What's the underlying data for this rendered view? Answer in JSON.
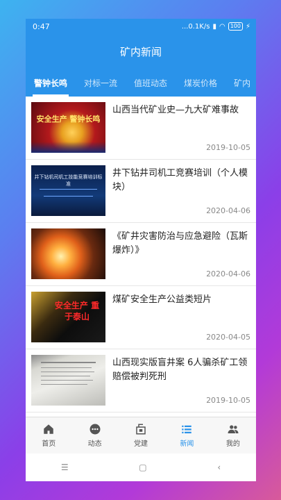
{
  "statusbar": {
    "time": "0:47",
    "speed": "...0.1K/s",
    "battery": "100"
  },
  "header": {
    "title": "矿内新闻"
  },
  "tabs": [
    {
      "label": "警钟长鸣"
    },
    {
      "label": "对标一流"
    },
    {
      "label": "值班动态"
    },
    {
      "label": "煤炭价格"
    },
    {
      "label": "矿内"
    }
  ],
  "news": [
    {
      "title": "山西当代矿业史—九大矿难事故",
      "date": "2019-10-05",
      "thumb_text": "安全生产 警钟长鸣"
    },
    {
      "title": "井下钻井司机工竞赛培训（个人模块）",
      "date": "2020-04-06",
      "thumb_text": "井下钻机司机工技能竞赛培训标准"
    },
    {
      "title": "《矿井灾害防治与应急避险（瓦斯爆炸）》",
      "date": "2020-04-06",
      "thumb_text": ""
    },
    {
      "title": "煤矿安全生产公益类短片",
      "date": "2020-04-05",
      "thumb_text": "安全生产 重于泰山"
    },
    {
      "title": "山西现实版盲井案 6人骗杀矿工领赔偿被判死刑",
      "date": "2019-10-05",
      "thumb_text": ""
    }
  ],
  "bottomnav": [
    {
      "label": "首页",
      "icon": "home-icon"
    },
    {
      "label": "动态",
      "icon": "chat-icon"
    },
    {
      "label": "党建",
      "icon": "party-icon"
    },
    {
      "label": "新闻",
      "icon": "news-list-icon"
    },
    {
      "label": "我的",
      "icon": "people-icon"
    }
  ],
  "colors": {
    "primary": "#2a93ea"
  }
}
